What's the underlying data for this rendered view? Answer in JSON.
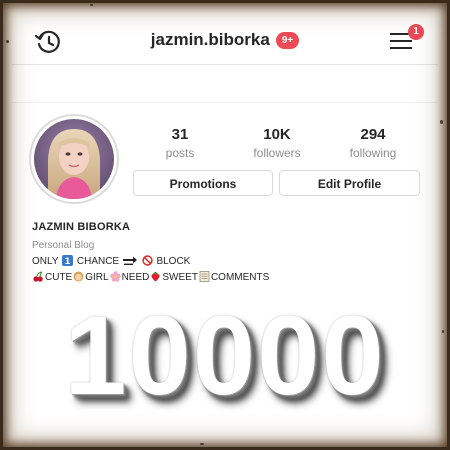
{
  "header": {
    "username": "jazmin.biborka",
    "notifications_pill": "9+",
    "menu_badge": "1"
  },
  "stats": [
    {
      "value": "31",
      "label": "posts"
    },
    {
      "value": "10K",
      "label": "followers"
    },
    {
      "value": "294",
      "label": "following"
    }
  ],
  "buttons": {
    "promotions": "Promotions",
    "edit_profile": "Edit Profile"
  },
  "bio": {
    "name": "JAZMIN BIBORKA",
    "category": "Personal Blog",
    "line1": {
      "word1": "ONLY",
      "word2": "CHANCE",
      "word3": "BLOCK",
      "emojis": [
        "keycap-1-icon",
        "soon-arrow-icon",
        "prohibited-icon"
      ]
    },
    "line2": {
      "word1": "CUTE",
      "word2": "GIRL",
      "word3": "NEED",
      "word4": "SWEET",
      "word5": "COMMENTS",
      "emojis": [
        "cherries-icon",
        "girl-icon",
        "blossom-icon",
        "strawberry-icon",
        "memo-icon"
      ]
    }
  },
  "overlay": {
    "big_number": "10000"
  },
  "colors": {
    "badge_red": "#ed4956",
    "text_dark": "#262626",
    "text_grey": "#8e8e8e",
    "border": "#dbdbdb"
  }
}
